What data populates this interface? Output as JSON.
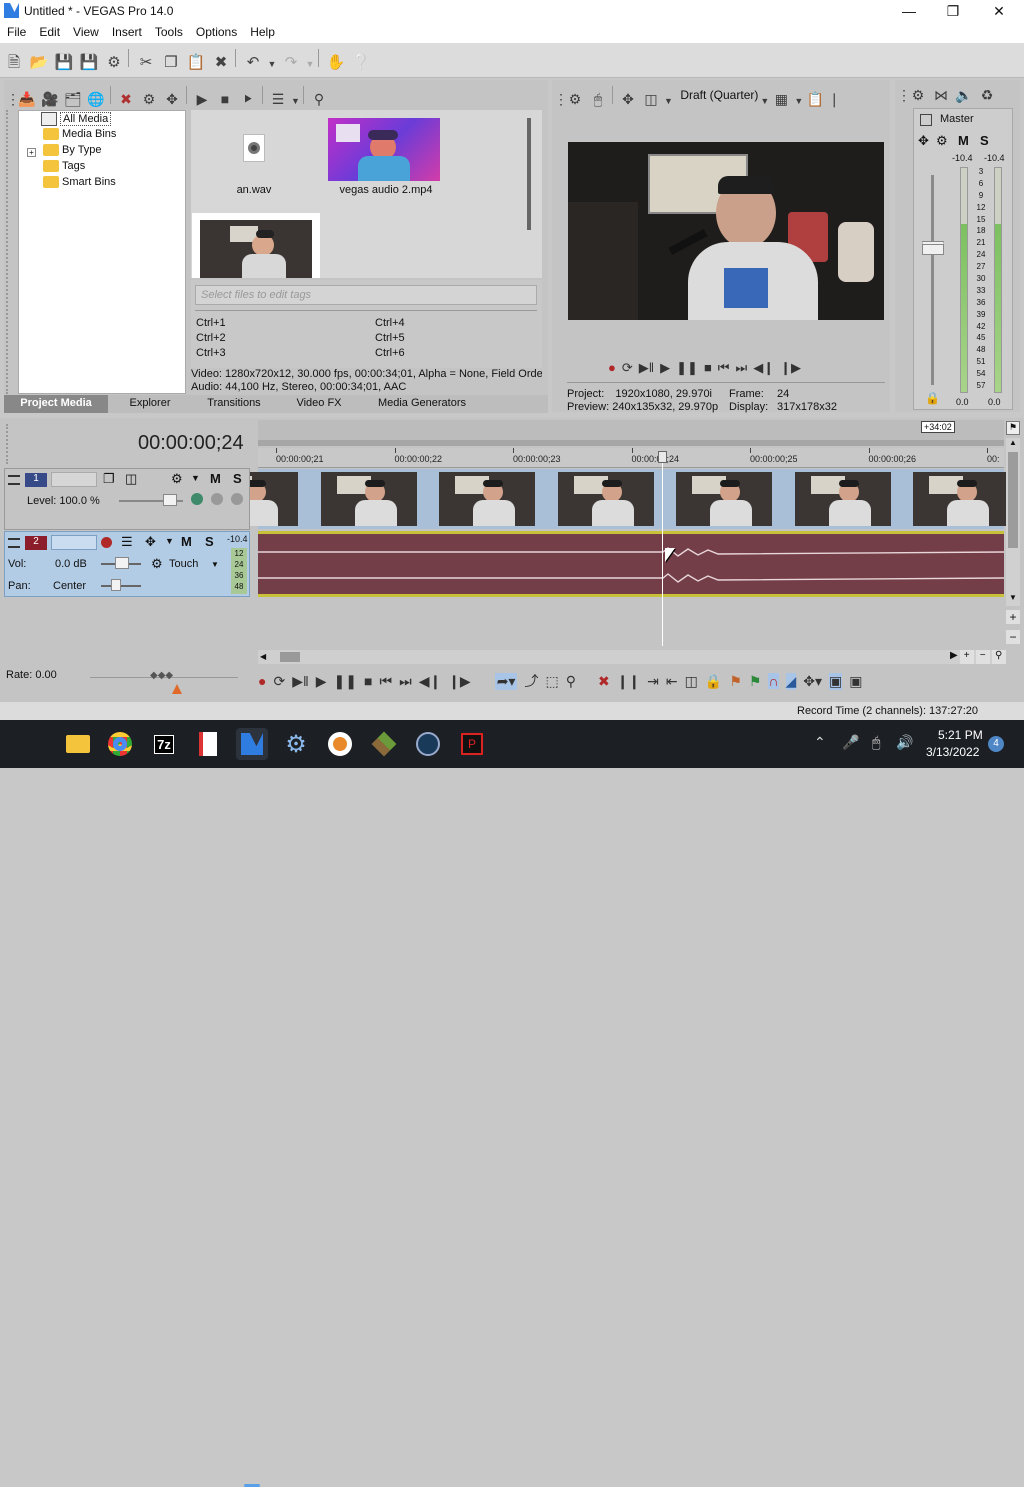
{
  "window": {
    "title": "Untitled * - VEGAS Pro 14.0",
    "app_icon": "vegas-logo-icon"
  },
  "menu": [
    "File",
    "Edit",
    "View",
    "Insert",
    "Tools",
    "Options",
    "Help"
  ],
  "media": {
    "tree": [
      "All Media",
      "Media Bins",
      "By Type",
      "Tags",
      "Smart Bins"
    ],
    "files": [
      {
        "name": "an.wav",
        "icon": "audio-file-icon"
      },
      {
        "name": "vegas audio 2.mp4",
        "icon": "video-thumbnail"
      }
    ],
    "tag_placeholder": "Select files to edit tags",
    "shortcuts": [
      "Ctrl+1",
      "Ctrl+4",
      "Ctrl+2",
      "Ctrl+5",
      "Ctrl+3",
      "Ctrl+6"
    ],
    "info_video": "Video: 1280x720x12, 30.000 fps, 00:00:34;01, Alpha = None, Field Orde",
    "info_audio": "Audio: 44,100 Hz, Stereo, 00:00:34;01, AAC",
    "tabs": [
      "Project Media",
      "Explorer",
      "Transitions",
      "Video FX",
      "Media Generators"
    ]
  },
  "preview": {
    "quality": "Draft (Quarter)",
    "project_label": "Project:",
    "project_value": "1920x1080, 29.970i",
    "preview_label": "Preview:",
    "preview_value": "240x135x32, 29.970p",
    "frame_label": "Frame:",
    "frame_value": "24",
    "display_label": "Display:",
    "display_value": "317x178x32"
  },
  "master": {
    "label": "Master",
    "m_label": "M",
    "s_label": "S",
    "peak_left": "-10.4",
    "peak_right": "-10.4",
    "scale": [
      "3",
      "6",
      "9",
      "12",
      "15",
      "18",
      "21",
      "24",
      "27",
      "30",
      "33",
      "36",
      "39",
      "42",
      "45",
      "48",
      "51",
      "54",
      "57"
    ],
    "readout_left": "0.0",
    "readout_right": "0.0"
  },
  "timeline": {
    "timecode": "00:00:00;24",
    "cursor_badge": "+34:02",
    "ruler": [
      "00:00:00;21",
      "00:00:00;22",
      "00:00:00;23",
      "00:00:00;24",
      "00:00:00;25",
      "00:00:00;26",
      "00:"
    ],
    "video_track": {
      "number": "1",
      "level": "Level: 100.0 %",
      "m": "M",
      "s": "S"
    },
    "audio_track": {
      "number": "2",
      "peak": "-10.4",
      "vol_label": "Vol:",
      "vol_value": "0.0 dB",
      "pan_label": "Pan:",
      "pan_value": "Center",
      "automation": "Touch",
      "m": "M",
      "s": "S",
      "meter_scale": [
        "12",
        "24",
        "36",
        "48"
      ]
    },
    "rate": "Rate: 0.00"
  },
  "status": {
    "record_time": "Record Time (2 channels): 137:27:20"
  },
  "taskbar": {
    "time": "5:21 PM",
    "date": "3/13/2022",
    "notifications": "4",
    "apps": [
      "start-icon",
      "file-explorer-icon",
      "chrome-icon",
      "7zip-icon",
      "document-app-icon",
      "vegas-pro-icon",
      "settings-icon",
      "media-player-icon",
      "minecraft-icon",
      "steam-icon",
      "media-app-icon"
    ]
  },
  "colors": {
    "audio_track": "#733e48",
    "video_track_bg": "#a9bfd7",
    "track_header_selected": "#b3cce6",
    "taskbar": "#1c1f24",
    "accent": "#4f86c6"
  }
}
